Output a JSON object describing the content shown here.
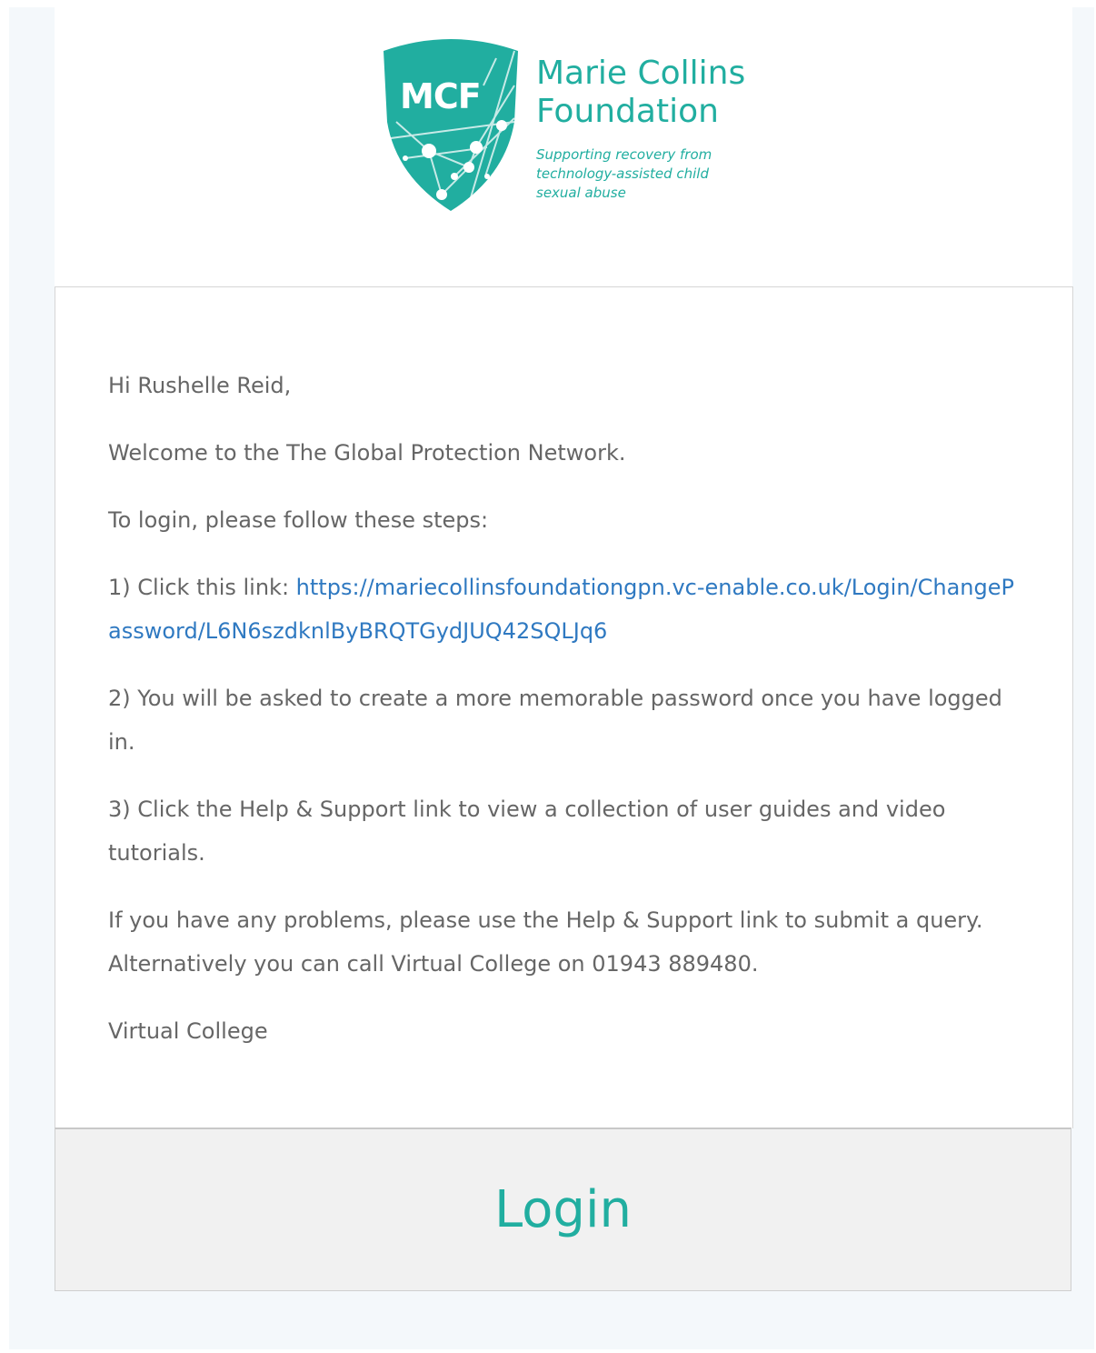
{
  "logo": {
    "initials": "MCF",
    "name_line1": "Marie Collins",
    "name_line2": "Foundation",
    "tagline_line1": "Supporting recovery from",
    "tagline_line2": "technology-assisted child",
    "tagline_line3": "sexual abuse",
    "icon": "mcf-shield-icon",
    "brand_color": "#21aea0"
  },
  "email": {
    "greeting": "Hi Rushelle Reid,",
    "welcome": "Welcome to the The Global Protection Network.",
    "intro": "To login, please follow these steps:",
    "step1_prefix": "1) Click this link: ",
    "step1_link": "https://mariecollinsfoundationgpn.vc-enable.co.uk/Login/ChangePassword/L6N6szdknlByBRQTGydJUQ42SQLJq6",
    "step2": "2) You will be asked to create a more memorable password once you have logged in.",
    "step3": "3) Click the Help & Support link to view a collection of user guides and video tutorials.",
    "problems": "If you have any problems, please use the Help & Support link to submit a query. Alternatively you can call Virtual College on 01943 889480.",
    "signature": "Virtual College",
    "link_color": "#2f79c1",
    "text_color": "#666666"
  },
  "footer": {
    "login_label": "Login"
  }
}
